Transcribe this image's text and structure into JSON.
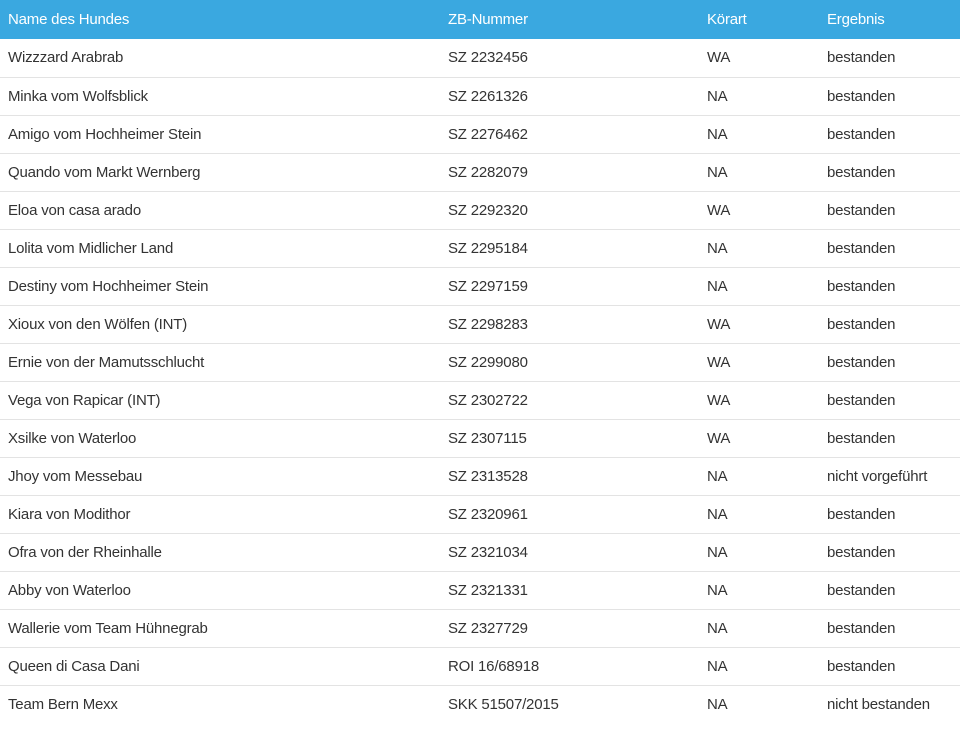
{
  "table": {
    "headers": [
      "Name des Hundes",
      "ZB-Nummer",
      "Körart",
      "Ergebnis"
    ],
    "rows": [
      [
        "Wizzzard Arabrab",
        "SZ 2232456",
        "WA",
        "bestanden"
      ],
      [
        "Minka vom Wolfsblick",
        "SZ 2261326",
        "NA",
        "bestanden"
      ],
      [
        "Amigo vom Hochheimer Stein",
        "SZ 2276462",
        "NA",
        "bestanden"
      ],
      [
        "Quando vom Markt Wernberg",
        "SZ 2282079",
        "NA",
        "bestanden"
      ],
      [
        "Eloa von casa arado",
        "SZ 2292320",
        "WA",
        "bestanden"
      ],
      [
        "Lolita vom Midlicher Land",
        "SZ 2295184",
        "NA",
        "bestanden"
      ],
      [
        "Destiny vom Hochheimer Stein",
        "SZ 2297159",
        "NA",
        "bestanden"
      ],
      [
        "Xioux von den Wölfen (INT)",
        "SZ 2298283",
        "WA",
        "bestanden"
      ],
      [
        "Ernie von der Mamutsschlucht",
        "SZ 2299080",
        "WA",
        "bestanden"
      ],
      [
        "Vega von Rapicar (INT)",
        "SZ 2302722",
        "WA",
        "bestanden"
      ],
      [
        "Xsilke von Waterloo",
        "SZ 2307115",
        "WA",
        "bestanden"
      ],
      [
        "Jhoy vom Messebau",
        "SZ 2313528",
        "NA",
        "nicht vorgeführt"
      ],
      [
        "Kiara von Modithor",
        "SZ 2320961",
        "NA",
        "bestanden"
      ],
      [
        "Ofra von der Rheinhalle",
        "SZ 2321034",
        "NA",
        "bestanden"
      ],
      [
        "Abby von Waterloo",
        "SZ 2321331",
        "NA",
        "bestanden"
      ],
      [
        "Wallerie vom Team Hühnegrab",
        "SZ 2327729",
        "NA",
        "bestanden"
      ],
      [
        "Queen di Casa Dani",
        "ROI 16/68918",
        "NA",
        "bestanden"
      ],
      [
        "Team Bern Mexx",
        "SKK 51507/2015",
        "NA",
        "nicht bestanden"
      ]
    ]
  },
  "colors": {
    "header_bg": "#3aa8e0",
    "header_text": "#ffffff",
    "row_text": "#333333",
    "divider": "#e3e3e3"
  }
}
